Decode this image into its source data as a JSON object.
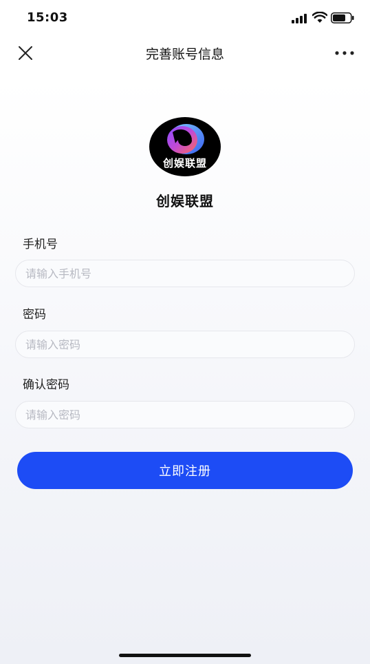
{
  "status_bar": {
    "time": "15:03",
    "icons": [
      "signal-icon",
      "wifi-icon",
      "battery-icon"
    ]
  },
  "nav": {
    "title": "完善账号信息",
    "close_icon": "close-icon",
    "more_icon": "more-icon"
  },
  "app": {
    "logo_text": "创娱联盟",
    "name": "创娱联盟"
  },
  "form": {
    "phone": {
      "label": "手机号",
      "placeholder": "请输入手机号",
      "value": ""
    },
    "password": {
      "label": "密码",
      "placeholder": "请输入密码",
      "value": ""
    },
    "confirm_password": {
      "label": "确认密码",
      "placeholder": "请输入密码",
      "value": ""
    },
    "submit_label": "立即注册"
  },
  "colors": {
    "primary": "#1d4cf5",
    "background_top": "#ffffff",
    "background_bottom": "#eef0f6"
  }
}
